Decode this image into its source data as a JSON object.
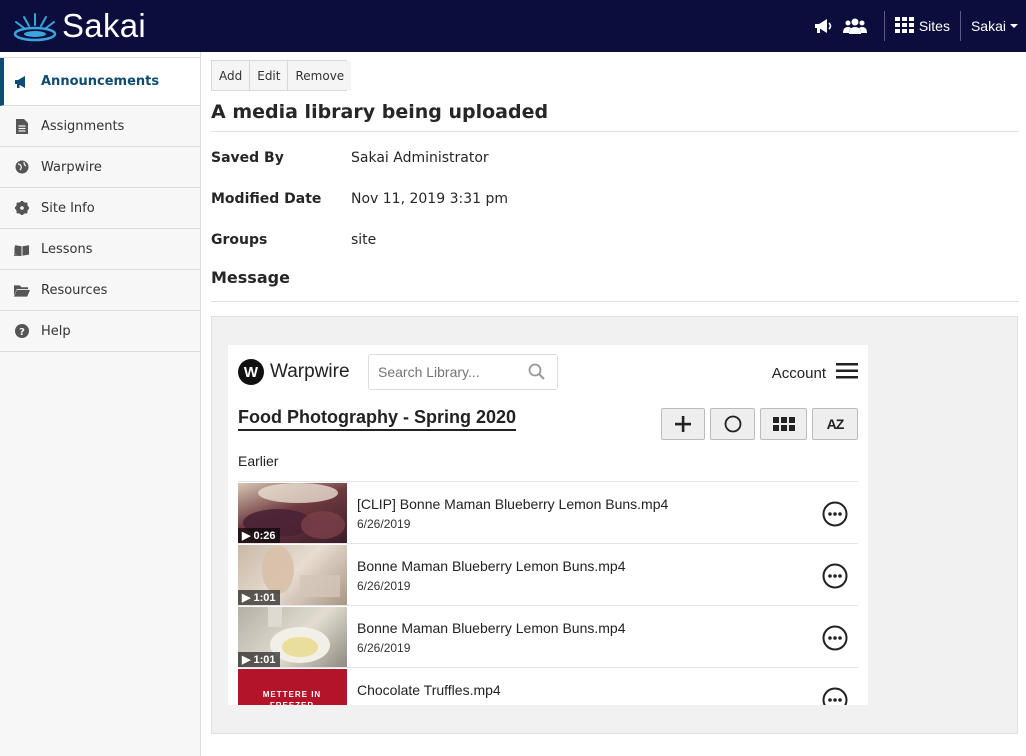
{
  "header": {
    "logo_text": "Sakai",
    "sites_label": "Sites",
    "user_label": "Sakai"
  },
  "sidebar": {
    "items": [
      {
        "label": "Announcements",
        "icon": "megaphone-icon",
        "active": true
      },
      {
        "label": "Assignments",
        "icon": "file-icon"
      },
      {
        "label": "Warpwire",
        "icon": "globe-icon"
      },
      {
        "label": "Site Info",
        "icon": "gear-icon"
      },
      {
        "label": "Lessons",
        "icon": "book-icon"
      },
      {
        "label": "Resources",
        "icon": "folder-icon"
      },
      {
        "label": "Help",
        "icon": "question-icon"
      }
    ]
  },
  "toolbar": {
    "add_label": "Add",
    "edit_label": "Edit",
    "remove_label": "Remove"
  },
  "announcement": {
    "title": "A media library being uploaded",
    "saved_by_label": "Saved By",
    "saved_by_value": "Sakai Administrator",
    "modified_label": "Modified Date",
    "modified_value": "Nov 11, 2019 3:31 pm",
    "groups_label": "Groups",
    "groups_value": "site",
    "message_label": "Message"
  },
  "warpwire": {
    "logo_letter": "W",
    "logo_name": "Warpwire",
    "search_placeholder": "Search Library...",
    "account_label": "Account",
    "collection_title": "Food Photography - Spring 2020",
    "sort_label": "AZ",
    "section_label": "Earlier",
    "items": [
      {
        "title": "[CLIP] Bonne Maman Blueberry Lemon Buns.mp4",
        "date": "6/26/2019",
        "duration": "▶ 0:26"
      },
      {
        "title": "Bonne Maman Blueberry Lemon Buns.mp4",
        "date": "6/26/2019",
        "duration": "▶ 1:01"
      },
      {
        "title": "Bonne Maman Blueberry Lemon Buns.mp4",
        "date": "6/26/2019",
        "duration": "▶ 1:01"
      },
      {
        "title": "Chocolate Truffles.mp4",
        "date": "",
        "duration": ""
      }
    ],
    "thumb4_text": "METTERE IN FREEZER"
  },
  "colors": {
    "topbar": "#0b0d3c",
    "active_nav": "#0f4b70"
  }
}
